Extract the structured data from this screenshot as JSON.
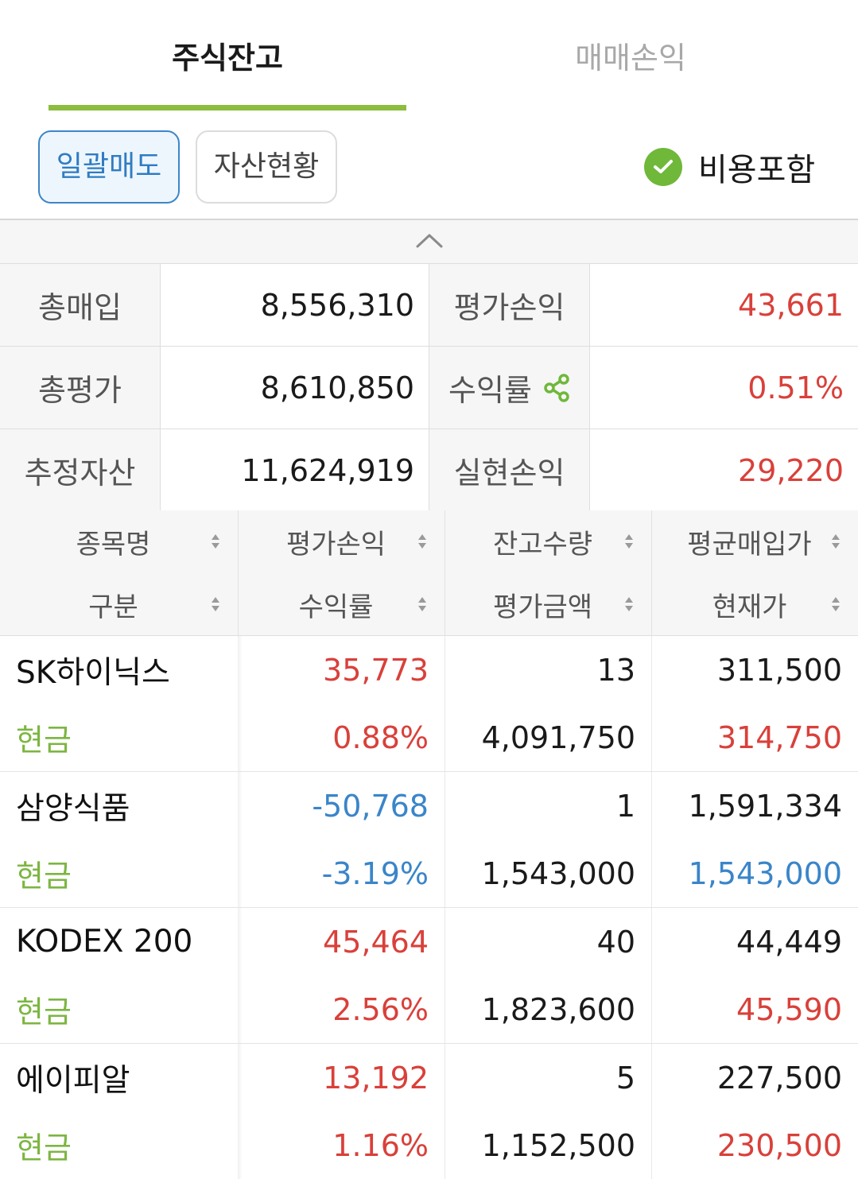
{
  "tabs": [
    {
      "label": "주식잔고",
      "active": true
    },
    {
      "label": "매매손익",
      "active": false
    }
  ],
  "actions": {
    "sell_all": "일괄매도",
    "asset_status": "자산현황",
    "include_fee": "비용포함",
    "include_fee_checked": true
  },
  "summary": {
    "total_buy_label": "총매입",
    "total_buy": "8,556,310",
    "eval_pl_label": "평가손익",
    "eval_pl": "43,661",
    "total_eval_label": "총평가",
    "total_eval": "8,610,850",
    "return_label": "수익률",
    "return_rate": "0.51%",
    "est_asset_label": "추정자산",
    "est_asset": "11,624,919",
    "realized_pl_label": "실현손익",
    "realized_pl": "29,220"
  },
  "table": {
    "headers": {
      "name": "종목명",
      "type": "구분",
      "eval_pl": "평가손익",
      "return_rate": "수익률",
      "qty": "잔고수량",
      "eval_amount": "평가금액",
      "avg_price": "평균매입가",
      "current_price": "현재가"
    },
    "rows": [
      {
        "name": "SK하이닉스",
        "type": "현금",
        "eval_pl": "35,773",
        "return_rate": "0.88%",
        "qty": "13",
        "eval_amount": "4,091,750",
        "avg_price": "311,500",
        "current_price": "314,750",
        "direction": "up"
      },
      {
        "name": "삼양식품",
        "type": "현금",
        "eval_pl": "-50,768",
        "return_rate": "-3.19%",
        "qty": "1",
        "eval_amount": "1,543,000",
        "avg_price": "1,591,334",
        "current_price": "1,543,000",
        "direction": "down"
      },
      {
        "name": "KODEX 200",
        "type": "현금",
        "eval_pl": "45,464",
        "return_rate": "2.56%",
        "qty": "40",
        "eval_amount": "1,823,600",
        "avg_price": "44,449",
        "current_price": "45,590",
        "direction": "up"
      },
      {
        "name": "에이피알",
        "type": "현금",
        "eval_pl": "13,192",
        "return_rate": "1.16%",
        "qty": "5",
        "eval_amount": "1,152,500",
        "avg_price": "227,500",
        "current_price": "230,500",
        "direction": "up"
      }
    ]
  },
  "colors": {
    "accent_green": "#8cbd3f",
    "check_green": "#6fb83a",
    "gain_red": "#d9403a",
    "loss_blue": "#3a85c9",
    "cash_green": "#7cb641",
    "button_blue": "#2f7cc3"
  },
  "icons": {
    "check": "check-circle-icon",
    "collapse": "chevron-up-icon",
    "share": "share-icon",
    "sort": "sort-icon"
  }
}
